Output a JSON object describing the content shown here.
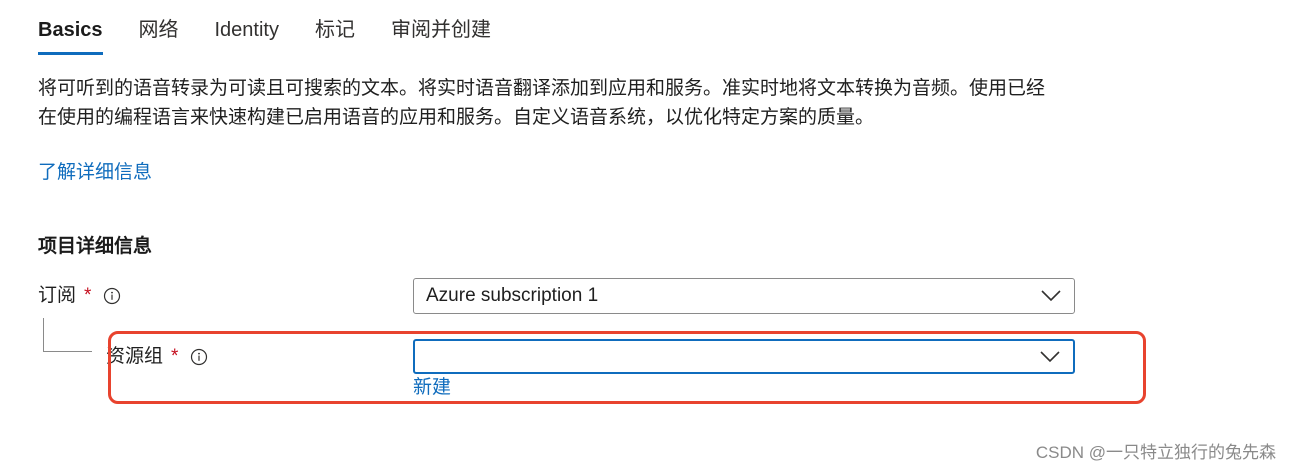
{
  "tabs": [
    {
      "label": "Basics",
      "active": true
    },
    {
      "label": "网络",
      "active": false
    },
    {
      "label": "Identity",
      "active": false
    },
    {
      "label": "标记",
      "active": false
    },
    {
      "label": "审阅并创建",
      "active": false
    }
  ],
  "description": {
    "line1": "将可听到的语音转录为可读且可搜索的文本。将实时语音翻译添加到应用和服务。准实时地将文本转换为音频。使用已经",
    "line2": "在使用的编程语言来快速构建已启用语音的应用和服务。自定义语音系统，以优化特定方案的质量。"
  },
  "learn_more": "了解详细信息",
  "section_title": "项目详细信息",
  "subscription": {
    "label": "订阅",
    "required_mark": "*",
    "value": "Azure subscription 1"
  },
  "resource_group": {
    "label": "资源组",
    "required_mark": "*",
    "value": "",
    "create_new": "新建"
  },
  "watermark": "CSDN @一只特立独行的兔先森",
  "colors": {
    "accent": "#0f6cbd",
    "required": "#c50f1f",
    "highlight": "#e8432e"
  }
}
